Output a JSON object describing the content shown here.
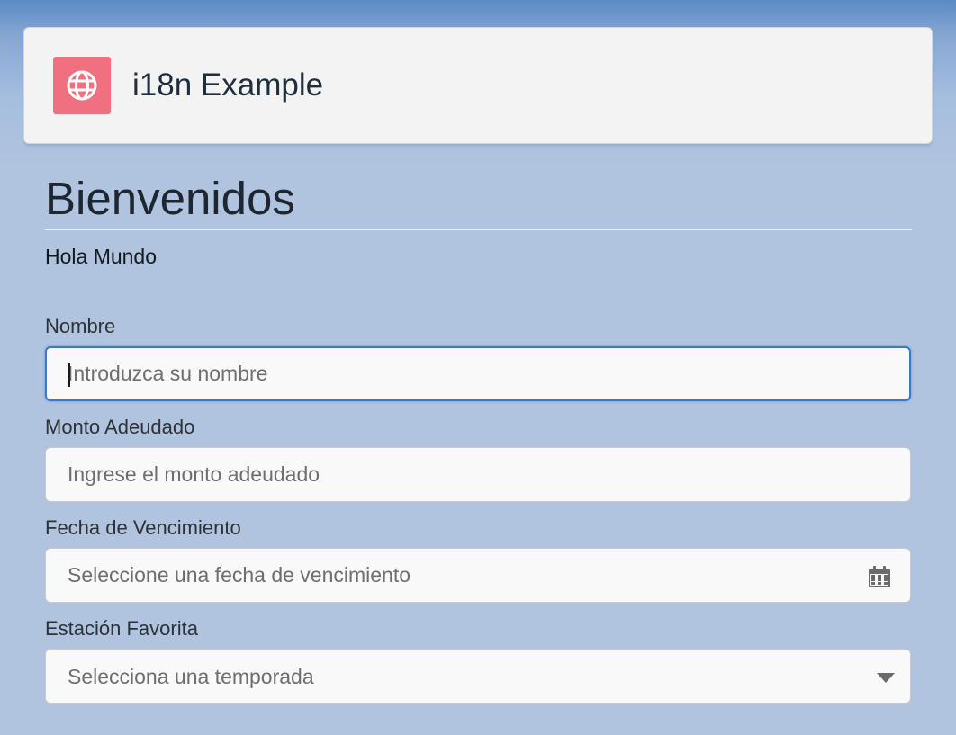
{
  "header": {
    "title": "i18n Example",
    "icon": "globe-icon",
    "icon_color": "#f0707f"
  },
  "main": {
    "heading": "Bienvenidos",
    "greeting": "Hola Mundo"
  },
  "form": {
    "name": {
      "label": "Nombre",
      "placeholder": "Introduzca su nombre",
      "value": ""
    },
    "amount": {
      "label": "Monto Adeudado",
      "placeholder": "Ingrese el monto adeudado",
      "value": ""
    },
    "due_date": {
      "label": "Fecha de Vencimiento",
      "placeholder": "Seleccione una fecha de vencimiento",
      "icon": "calendar-icon",
      "value": ""
    },
    "season": {
      "label": "Estación Favorita",
      "placeholder": "Selecciona una temporada",
      "icon": "chevron-down-icon"
    }
  },
  "colors": {
    "background": "#b0c4df",
    "focus_border": "#3a78c9"
  }
}
